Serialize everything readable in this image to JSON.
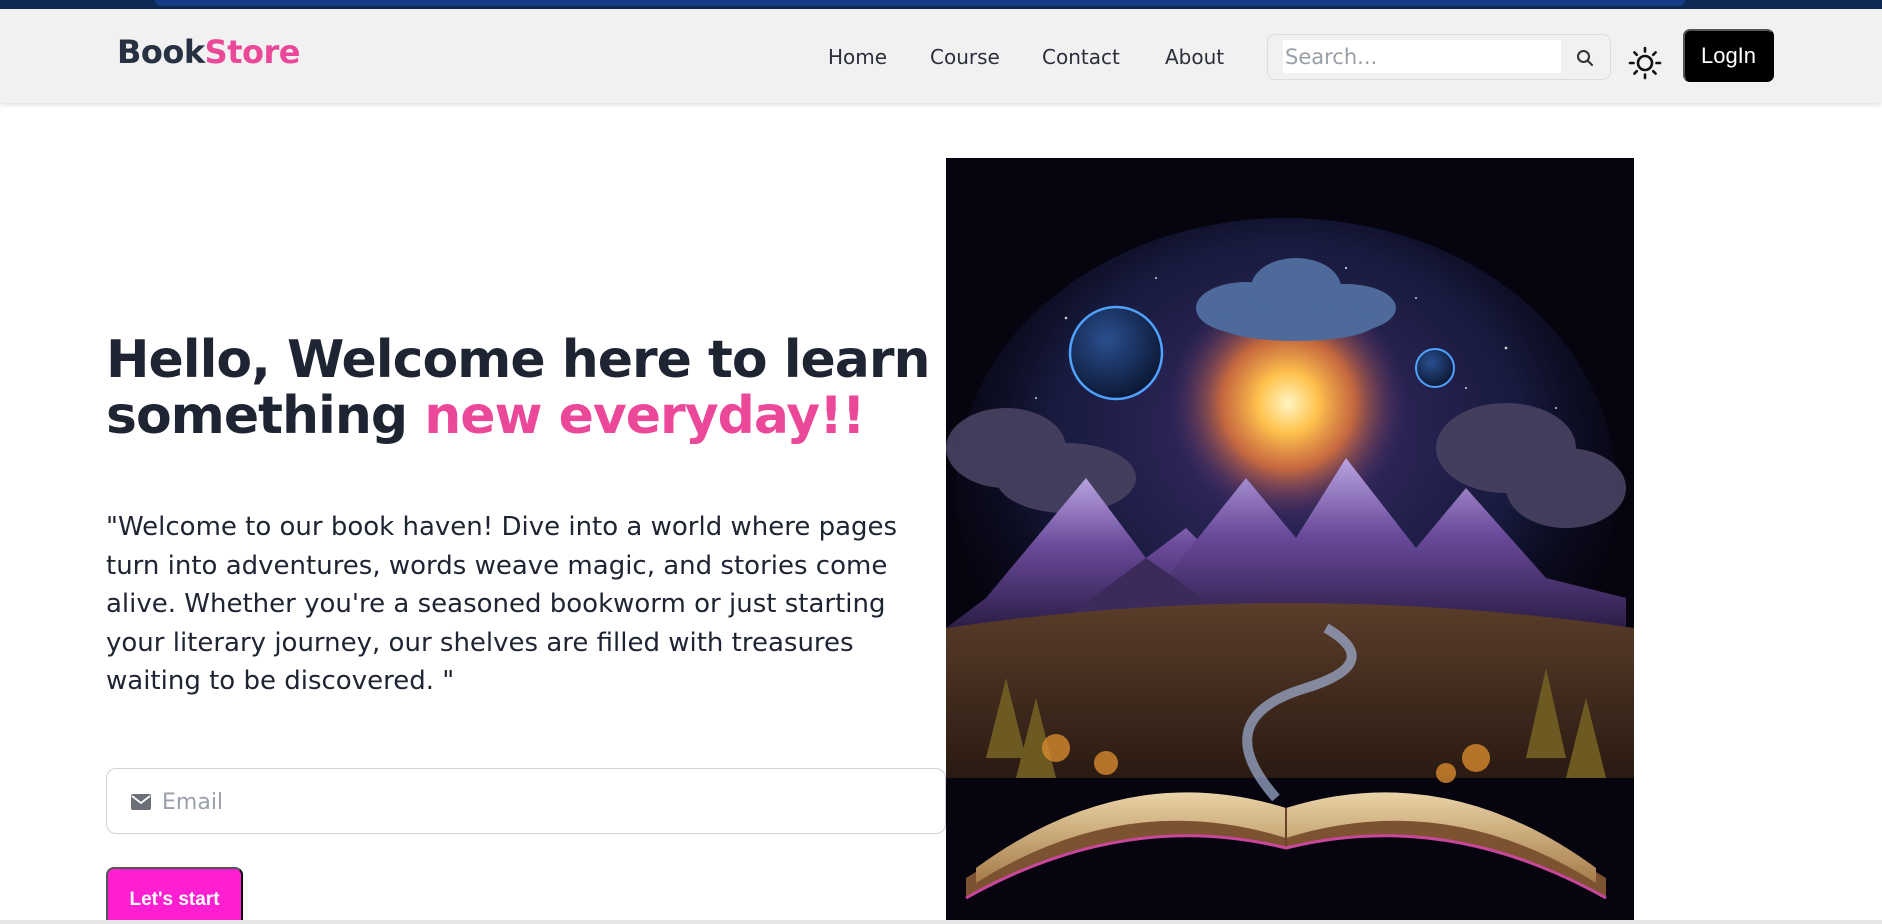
{
  "brand": {
    "part1": "Book",
    "part2": "Store"
  },
  "nav": {
    "items": [
      {
        "label": "Home"
      },
      {
        "label": "Course"
      },
      {
        "label": "Contact"
      },
      {
        "label": "About"
      }
    ]
  },
  "search": {
    "placeholder": "Search..."
  },
  "login": {
    "label": "LogIn"
  },
  "hero": {
    "title_line1": "Hello, Welcome here to learn",
    "title_line2_plain": "something ",
    "title_line2_accent": "new everyday!!",
    "description": "\"Welcome to our book haven! Dive into a world where pages turn into adventures, words weave magic, and stories come alive. Whether you're a seasoned bookworm or just starting your literary journey, our shelves are filled with treasures waiting to be discovered. \"",
    "email_placeholder": "Email",
    "cta_label": "Let's start"
  },
  "colors": {
    "accent": "#ec4899",
    "cta": "#ff1fd2",
    "text": "#1f2433",
    "navbar_bg": "#f1f1f2",
    "login_bg": "#000000"
  },
  "icons": {
    "search": "search-icon",
    "theme": "sun-icon",
    "email": "envelope-icon",
    "hero_image": "open-book-fantasy-landscape"
  }
}
